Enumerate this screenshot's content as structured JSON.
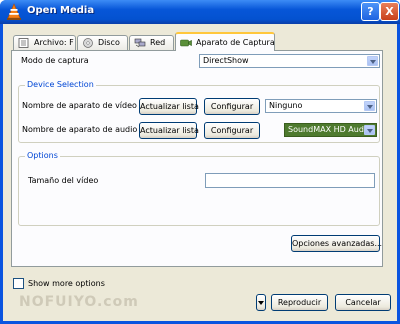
{
  "window": {
    "title": "Open Media",
    "help_label": "?",
    "close_label": "X"
  },
  "tabs": [
    {
      "label": "Archivo: F",
      "icon": "file-icon",
      "active": false
    },
    {
      "label": "Disco",
      "icon": "disc-icon",
      "active": false
    },
    {
      "label": "Red",
      "icon": "network-icon",
      "active": false
    },
    {
      "label": "Aparato de Captura",
      "icon": "capture-device-icon",
      "active": true
    }
  ],
  "capture_mode": {
    "label": "Modo de captura",
    "value": "DirectShow"
  },
  "device_selection": {
    "title": "Device Selection",
    "video": {
      "label": "Nombre de aparato de vídeo",
      "refresh_label": "Actualizar lista",
      "configure_label": "Configurar",
      "value": "Ninguno"
    },
    "audio": {
      "label": "Nombre de aparato de audio",
      "refresh_label": "Actualizar lista",
      "configure_label": "Configurar",
      "value": "SoundMAX HD Audio"
    }
  },
  "options": {
    "title": "Options",
    "video_size_label": "Tamaño del vídeo",
    "video_size_value": ""
  },
  "advanced_options_label": "Opciones avanzadas...",
  "show_more_options": {
    "label": "Show more options",
    "checked": false
  },
  "watermark": "NOFUIYO.com",
  "footer": {
    "play_label": "Reproducir",
    "cancel_label": "Cancelar"
  }
}
